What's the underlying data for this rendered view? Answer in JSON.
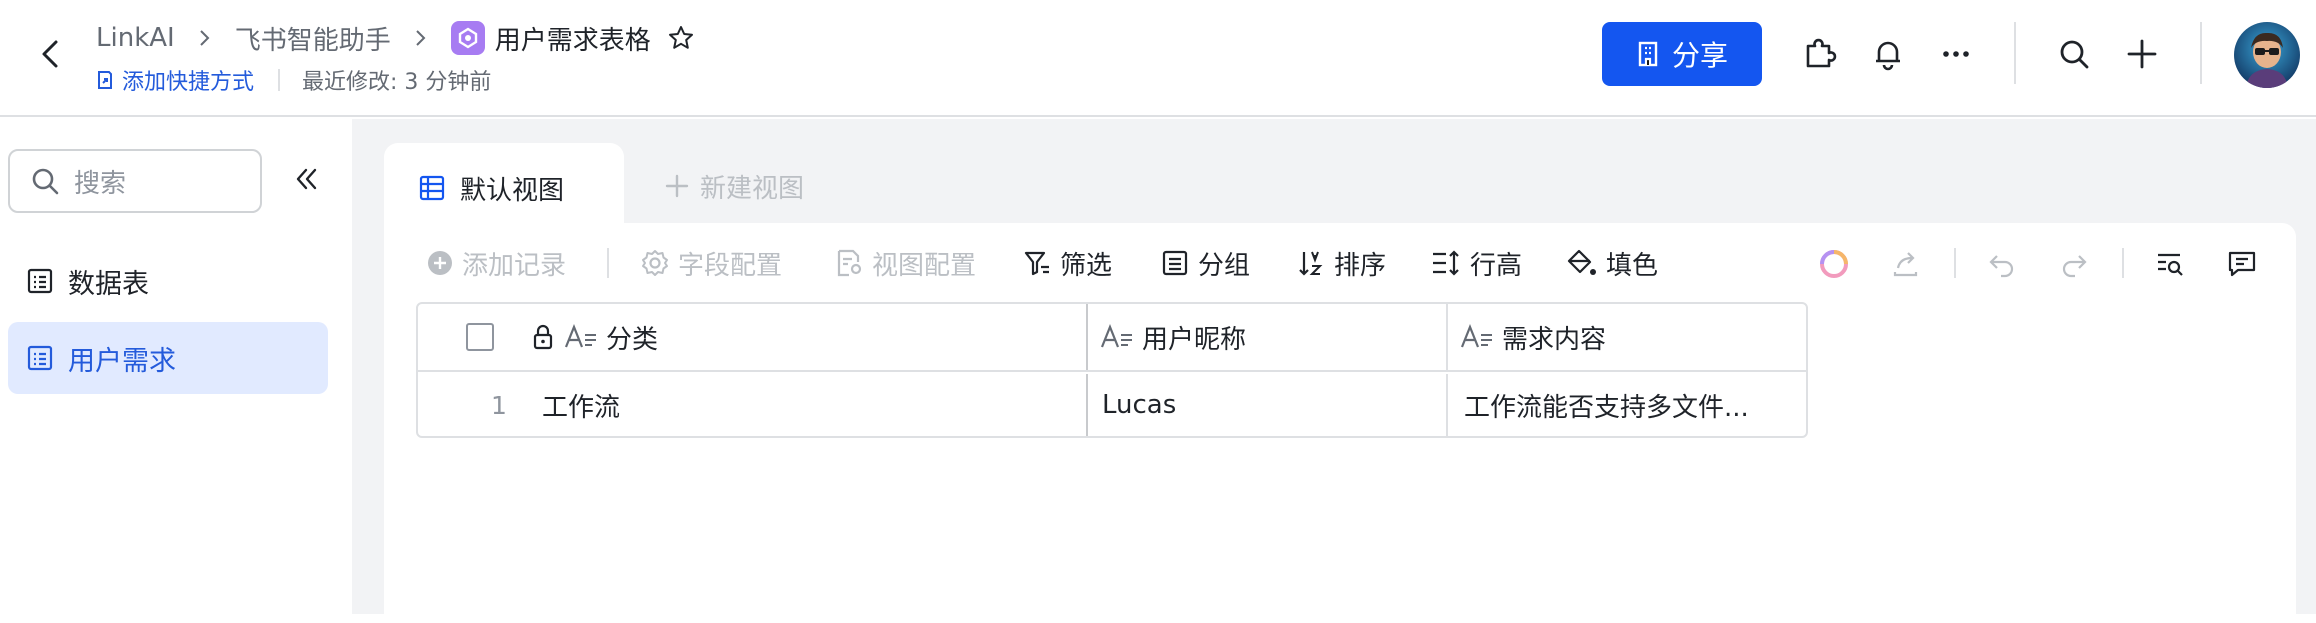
{
  "header": {
    "breadcrumbs": [
      "LinkAI",
      "飞书智能助手",
      "用户需求表格"
    ],
    "add_shortcut": "添加快捷方式",
    "last_modified": "最近修改: 3 分钟前",
    "share_label": "分享",
    "icons": [
      "back-icon",
      "puzzle-icon",
      "bell-icon",
      "more-icon",
      "search-icon",
      "plus-icon"
    ]
  },
  "sidebar": {
    "search_placeholder": "搜索",
    "items": [
      {
        "label": "数据表",
        "active": false
      },
      {
        "label": "用户需求",
        "active": true
      }
    ]
  },
  "views": {
    "active_tab": "默认视图",
    "new_view": "新建视图"
  },
  "toolbar": {
    "add_record": "添加记录",
    "field_config": "字段配置",
    "view_config": "视图配置",
    "filter": "筛选",
    "group": "分组",
    "sort": "排序",
    "row_height": "行高",
    "fill_color": "填色"
  },
  "table": {
    "columns": [
      "分类",
      "用户昵称",
      "需求内容"
    ],
    "rows": [
      {
        "num": "1",
        "cells": [
          "工作流",
          "Lucas",
          "工作流能否支持多文件..."
        ]
      }
    ]
  },
  "colors": {
    "accent": "#1456f0",
    "link": "#245bdb",
    "active_bg": "#e1eaff",
    "canvas_bg": "#f2f3f5"
  }
}
